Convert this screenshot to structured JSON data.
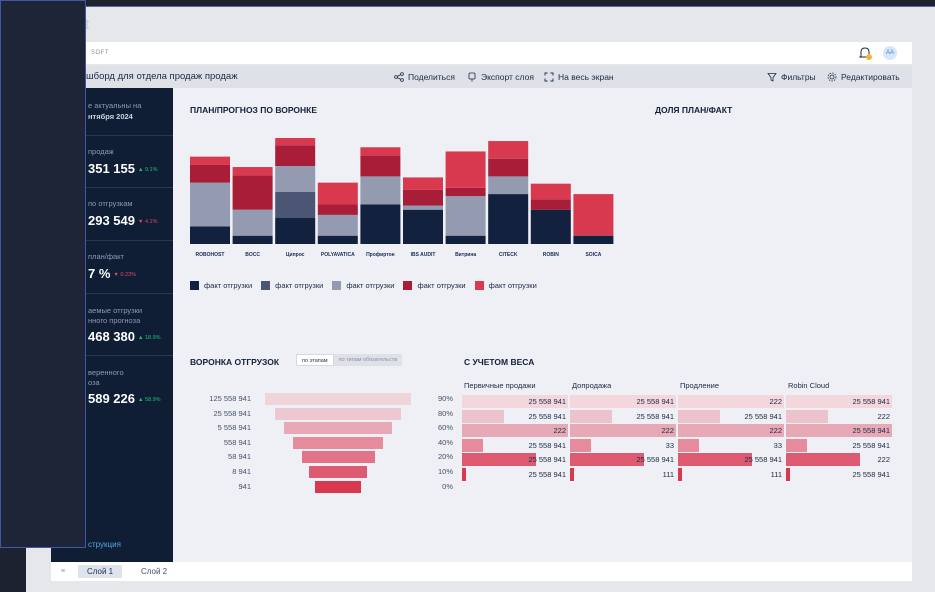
{
  "app": {
    "title": "t",
    "brand": "SOFT",
    "avatar": "АА"
  },
  "toolbar": {
    "dashboard_title": "шборд для отдела продаж продаж",
    "share": "Поделиться",
    "export": "Экспорт слоя",
    "fullscreen": "На весь экран",
    "filters": "Фильтры",
    "edit": "Редактировать"
  },
  "sidebar": {
    "header_line1": "е актуальны на",
    "header_line2": "нтября 2024",
    "kpis": [
      {
        "label": "продаж",
        "value": "351 155",
        "delta": "▲ 9.1%",
        "delta_color": "#21c27a"
      },
      {
        "label": "по отгрузкам",
        "value": "293 549",
        "delta": "▼ 4.1%",
        "delta_color": "#e4476a"
      },
      {
        "label": "план/факт",
        "value": "7 %",
        "delta": "▼ 0.23%",
        "delta_color": "#e4476a"
      },
      {
        "label": "аемые отгрузки",
        "label2": "нного прогноза",
        "value": "468 380",
        "delta": "▲ 18.9%",
        "delta_color": "#21c27a"
      },
      {
        "label": "веренного",
        "label2": "оза",
        "value": "589 226",
        "delta": "▲ 58.9%",
        "delta_color": "#21c27a"
      }
    ],
    "link": "струкция"
  },
  "plan_chart": {
    "title": "ПЛАН/ПРОГНОЗ ПО ВОРОНКЕ",
    "share_title": "ДОЛЯ ПЛАН/ФАКТ",
    "logos": [
      "ROBOHOST",
      "BOCC",
      "Ципрос",
      "POLYAVATICA",
      "Профиртон",
      "IBS AUDIT",
      "Витрина",
      "CITECK",
      "ROBIN",
      "SOICA"
    ],
    "legend": [
      "факт отгрузки",
      "факт отгрузки",
      "факт отгрузки",
      "факт отгрузки",
      "факт отгрузки"
    ]
  },
  "chart_data": {
    "type": "bar",
    "stacked": true,
    "categories": [
      "ROBOHOST",
      "BOCC",
      "Ципрос",
      "POLYAVATICA",
      "Профиртон",
      "IBS AUDIT",
      "Витрина",
      "CITECK",
      "ROBIN",
      "SOICA"
    ],
    "series": [
      {
        "name": "факт отгрузки",
        "color": "#12213d",
        "values": [
          17,
          8,
          25,
          8,
          38,
          33,
          8,
          48,
          33,
          8
        ]
      },
      {
        "name": "факт отгрузки",
        "color": "#4a5674",
        "values": [
          0,
          0,
          25,
          0,
          0,
          0,
          0,
          0,
          0,
          0
        ]
      },
      {
        "name": "факт отгрузки",
        "color": "#949bb0",
        "values": [
          42,
          25,
          25,
          20,
          27,
          4,
          38,
          17,
          0,
          0
        ]
      },
      {
        "name": "факт отгрузки",
        "color": "#a81e38",
        "values": [
          17,
          33,
          20,
          10,
          20,
          15,
          8,
          17,
          10,
          0
        ]
      },
      {
        "name": "факт отгрузки",
        "color": "#d9394f",
        "values": [
          8,
          8,
          10,
          21,
          8,
          12,
          35,
          17,
          15,
          40
        ]
      }
    ]
  },
  "funnel": {
    "title": "ВОРОНКА ОТГРУЗОК",
    "toggle_on": "по этапам",
    "toggle_off": "по типам обязательств",
    "labels": [
      "125 558 941",
      "25 558 941",
      "5 558 941",
      "558 941",
      "58 941",
      "8 941",
      "941"
    ],
    "percents": [
      "90%",
      "80%",
      "60%",
      "40%",
      "20%",
      "10%",
      "0%"
    ],
    "widths": [
      1.0,
      0.86,
      0.74,
      0.62,
      0.5,
      0.4,
      0.32
    ],
    "colors": [
      "#efd5da",
      "#edc8d0",
      "#e8a9b6",
      "#e58b9c",
      "#e37386",
      "#de5a70",
      "#d9394f"
    ]
  },
  "weighted": {
    "title": "С УЧЕТОМ ВЕСА",
    "columns": [
      "Первичные продажи",
      "Допродажа",
      "Продление",
      "Robin Cloud"
    ],
    "rows": [
      {
        "color": "#f3d7dd",
        "cells": [
          {
            "text": "25 558 941",
            "fill": 1.0
          },
          {
            "text": "25 558 941",
            "fill": 1.0
          },
          {
            "text": "222",
            "fill": 1.0
          },
          {
            "text": "25 558 941",
            "fill": 1.0
          }
        ]
      },
      {
        "color": "#ecc3cc",
        "cells": [
          {
            "text": "25 558 941",
            "fill": 0.4
          },
          {
            "text": "25 558 941",
            "fill": 0.4
          },
          {
            "text": "25 558 941",
            "fill": 0.4
          },
          {
            "text": "222",
            "fill": 0.4
          }
        ]
      },
      {
        "color": "#e8a9b6",
        "cells": [
          {
            "text": "222",
            "fill": 1.0
          },
          {
            "text": "222",
            "fill": 1.0
          },
          {
            "text": "222",
            "fill": 1.0
          },
          {
            "text": "25 558 941",
            "fill": 1.0
          }
        ]
      },
      {
        "color": "#e58b9c",
        "cells": [
          {
            "text": "25 558 941",
            "fill": 0.2
          },
          {
            "text": "33",
            "fill": 0.2
          },
          {
            "text": "33",
            "fill": 0.2
          },
          {
            "text": "25 558 941",
            "fill": 0.2
          }
        ]
      },
      {
        "color": "#de5a70",
        "cells": [
          {
            "text": "25 558 941",
            "fill": 0.7
          },
          {
            "text": "25 558 941",
            "fill": 0.7
          },
          {
            "text": "25 558 941",
            "fill": 0.7
          },
          {
            "text": "222",
            "fill": 0.7
          }
        ]
      },
      {
        "color": "#d9394f",
        "cells": [
          {
            "text": "25 558 941",
            "fill": 0.04
          },
          {
            "text": "111",
            "fill": 0.04
          },
          {
            "text": "111",
            "fill": 0.04
          },
          {
            "text": "25 558 941",
            "fill": 0.04
          }
        ]
      }
    ]
  },
  "layers": {
    "tabs": [
      "Слой 1",
      "Слой 2"
    ],
    "menu_icon": "≡"
  }
}
